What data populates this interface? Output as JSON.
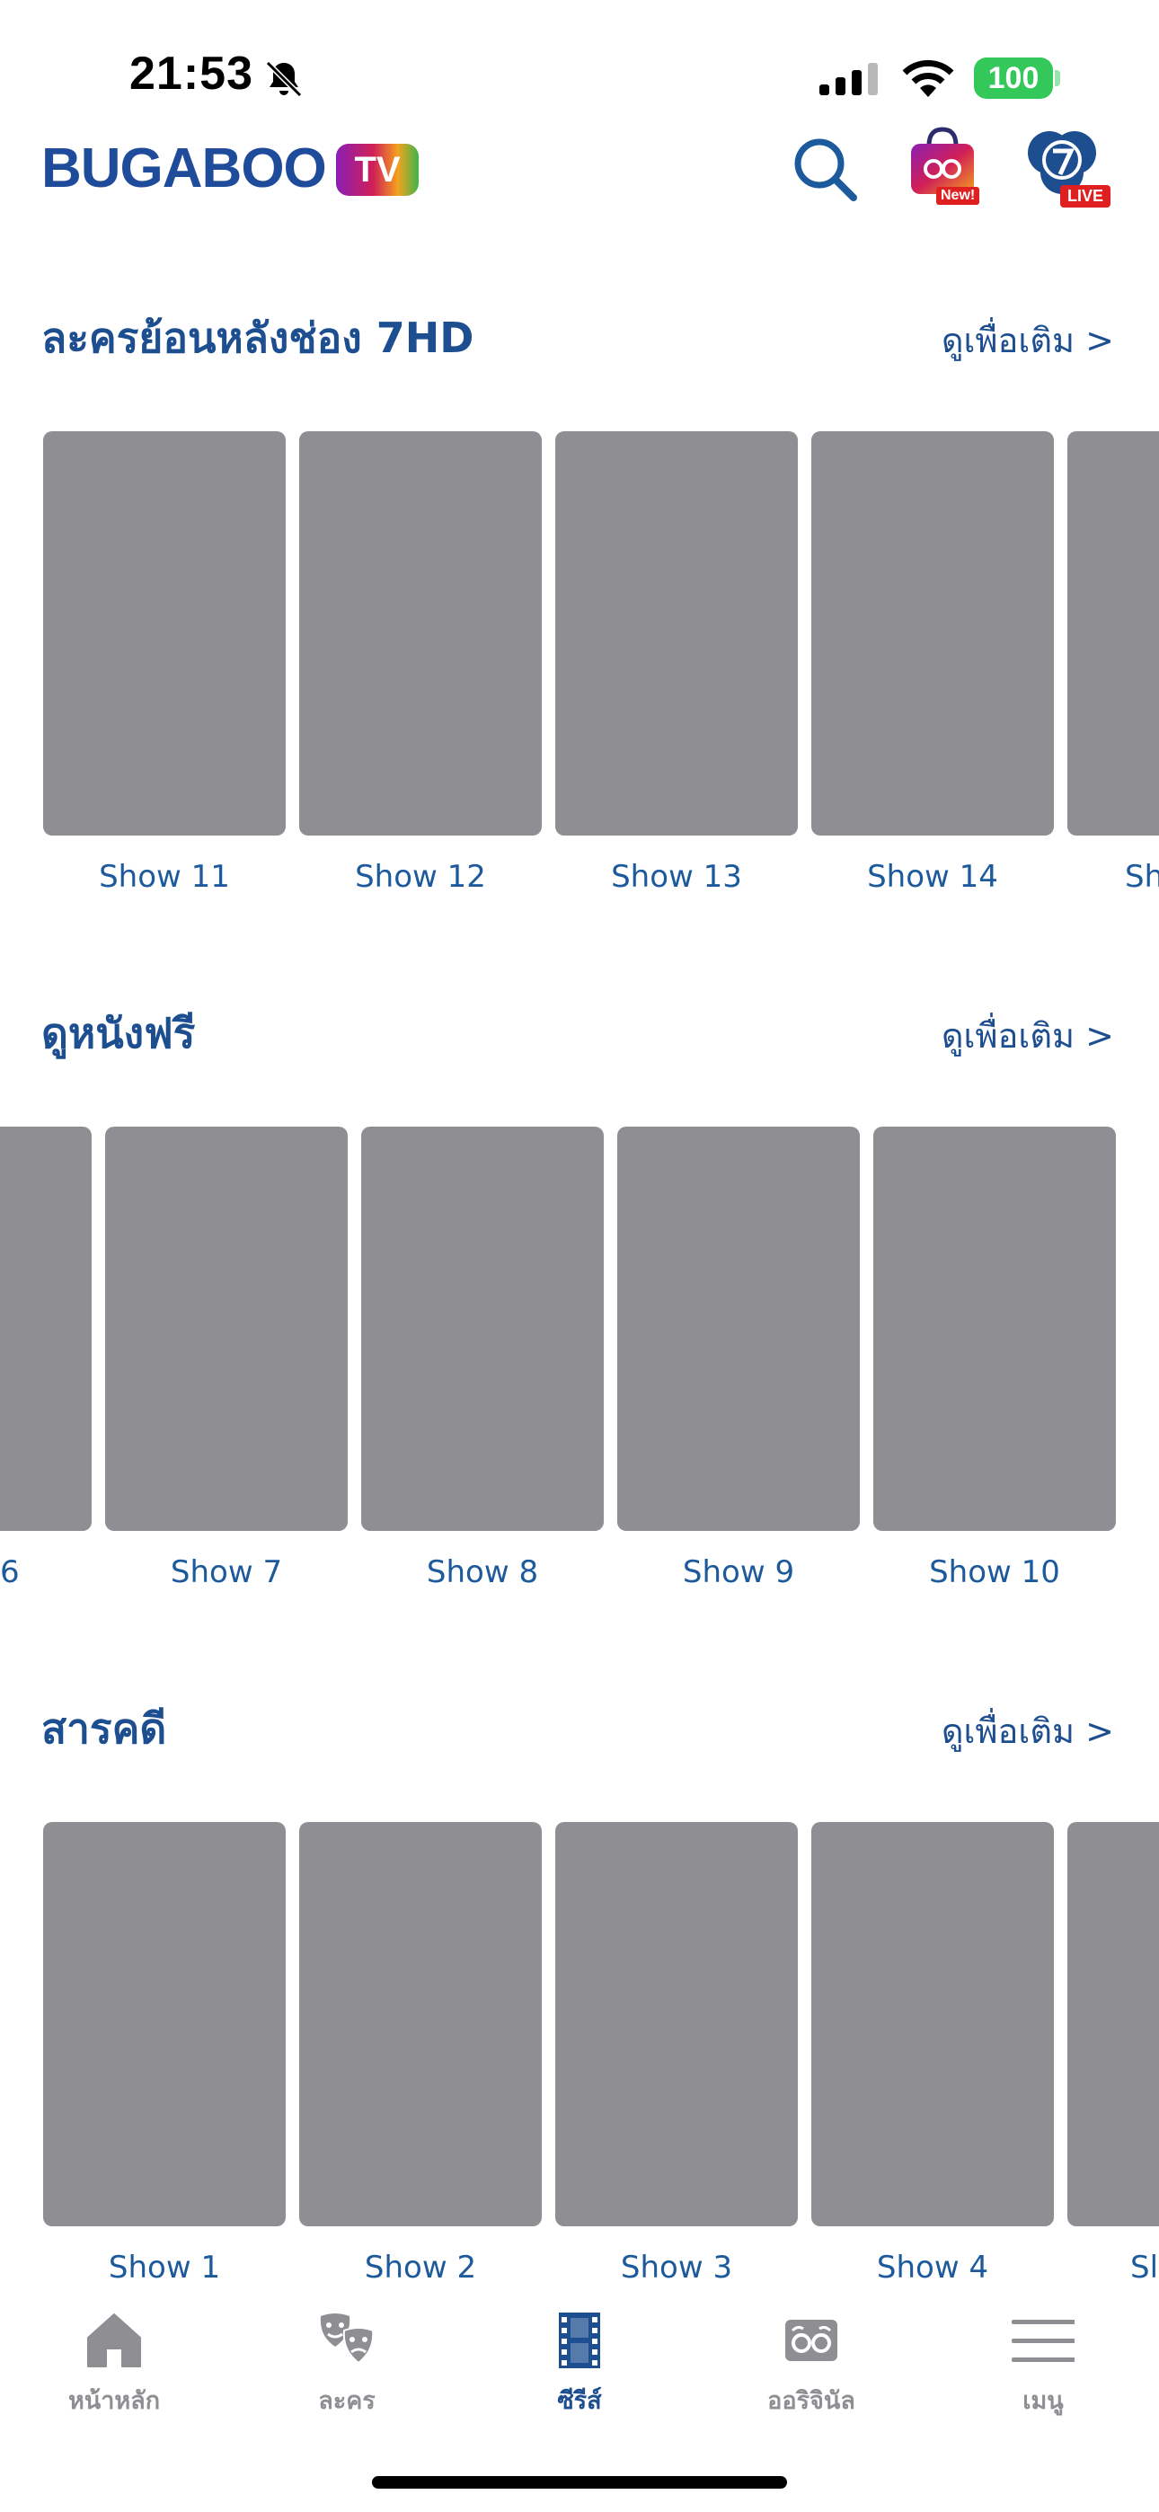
{
  "status_bar": {
    "time": "21:53",
    "battery": "100"
  },
  "header": {
    "logo_text": "BUGABOO",
    "logo_badge": "TV",
    "shop_badge": "New!",
    "live_badge": "LIVE"
  },
  "sections": [
    {
      "title": "ละครย้อนหลังช่อง 7HD",
      "see_more": "ดูเพื่อเติม >",
      "items": [
        "Show 11",
        "Show 12",
        "Show 13",
        "Show 14",
        "Sh"
      ]
    },
    {
      "title": "ดูหนังฟรี",
      "see_more": "ดูเพื่อเติม >",
      "items": [
        "6",
        "Show 7",
        "Show 8",
        "Show 9",
        "Show 10"
      ]
    },
    {
      "title": "สารคดี",
      "see_more": "ดูเพื่อเติม >",
      "items": [
        "Show 1",
        "Show 2",
        "Show 3",
        "Show 4",
        "Sl"
      ]
    }
  ],
  "tab_bar": {
    "tabs": [
      {
        "label": "หน้าหลัก",
        "icon": "home-icon",
        "active": false
      },
      {
        "label": "ละคร",
        "icon": "drama-masks-icon",
        "active": false
      },
      {
        "label": "ซีรีส์",
        "icon": "film-strip-icon",
        "active": true
      },
      {
        "label": "ออริจินัล",
        "icon": "bugaboo-eyes-icon",
        "active": false
      },
      {
        "label": "เมนู",
        "icon": "hamburger-menu-icon",
        "active": false
      }
    ]
  },
  "colors": {
    "brand_blue": "#1d4e8f",
    "poster_gray": "#8e8e93",
    "battery_green": "#34c759",
    "live_red": "#e02020"
  }
}
